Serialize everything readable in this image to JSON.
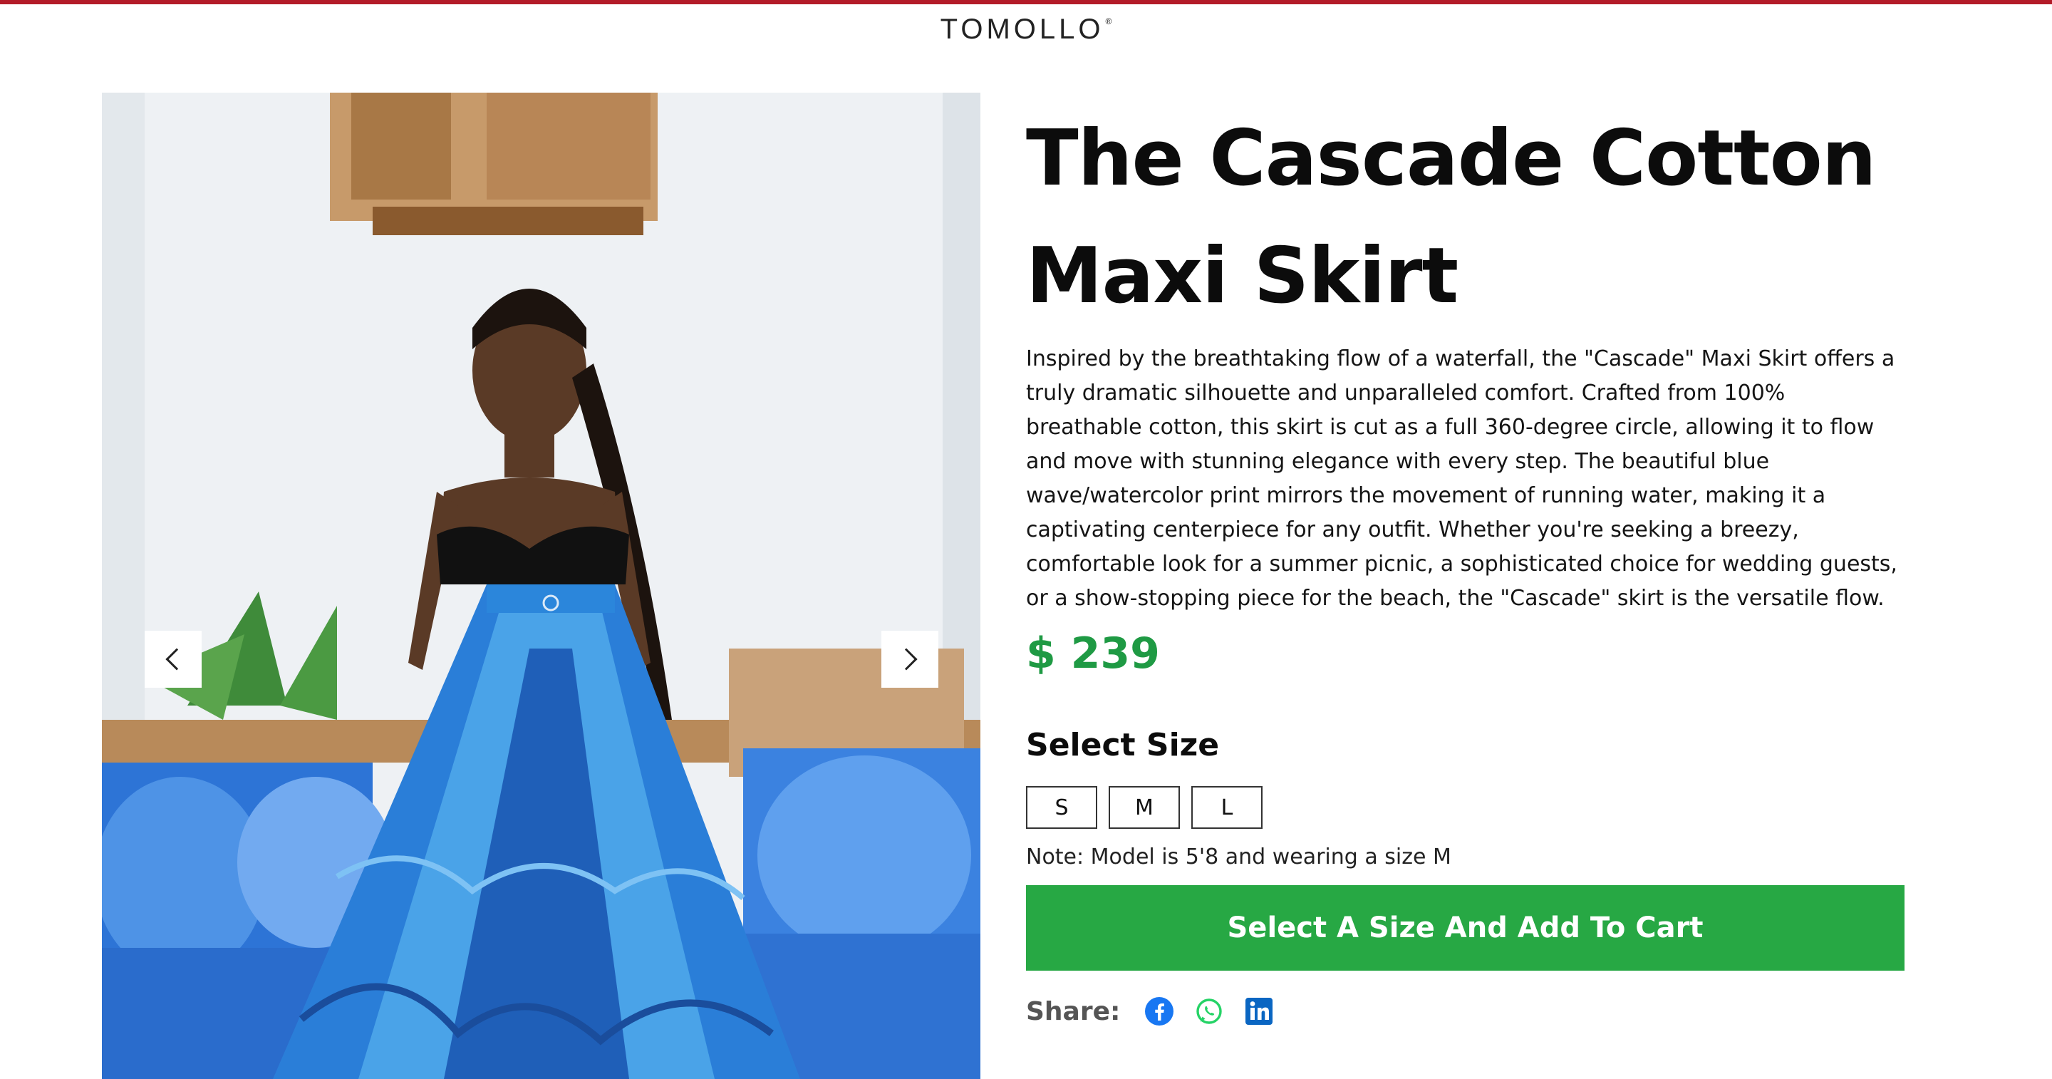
{
  "header": {
    "logo": "TOMOLLO",
    "registered_mark": "®"
  },
  "gallery": {
    "prev_icon": "chevron-left-icon",
    "next_icon": "chevron-right-icon"
  },
  "product": {
    "title": "The Cascade Cotton Maxi Skirt",
    "description": "Inspired by the breathtaking flow of a waterfall, the \"Cascade\" Maxi Skirt offers a truly dramatic silhouette and unparalleled comfort. Crafted from 100% breathable cotton, this skirt is cut as a full 360-degree circle, allowing it to flow and move with stunning elegance with every step. The beautiful blue wave/watercolor print mirrors the movement of running water, making it a captivating centerpiece for any outfit. Whether you're seeking a breezy, comfortable look for a summer picnic, a sophisticated choice for wedding guests, or a show-stopping piece for the beach, the \"Cascade\" skirt is the versatile flow.",
    "price": "$ 239",
    "size_heading": "Select Size",
    "sizes": [
      "S",
      "M",
      "L"
    ],
    "note": "Note: Model is 5'8 and wearing a size M",
    "cart_button": "Select A Size And Add To Cart"
  },
  "share": {
    "label": "Share:",
    "icons": [
      "facebook-icon",
      "whatsapp-icon",
      "linkedin-icon"
    ]
  },
  "colors": {
    "accent_green": "#27a844",
    "price_green": "#1f9a44",
    "top_line": "#b31b28",
    "facebook": "#1877f2",
    "whatsapp": "#25d366",
    "linkedin": "#0a66c2"
  }
}
